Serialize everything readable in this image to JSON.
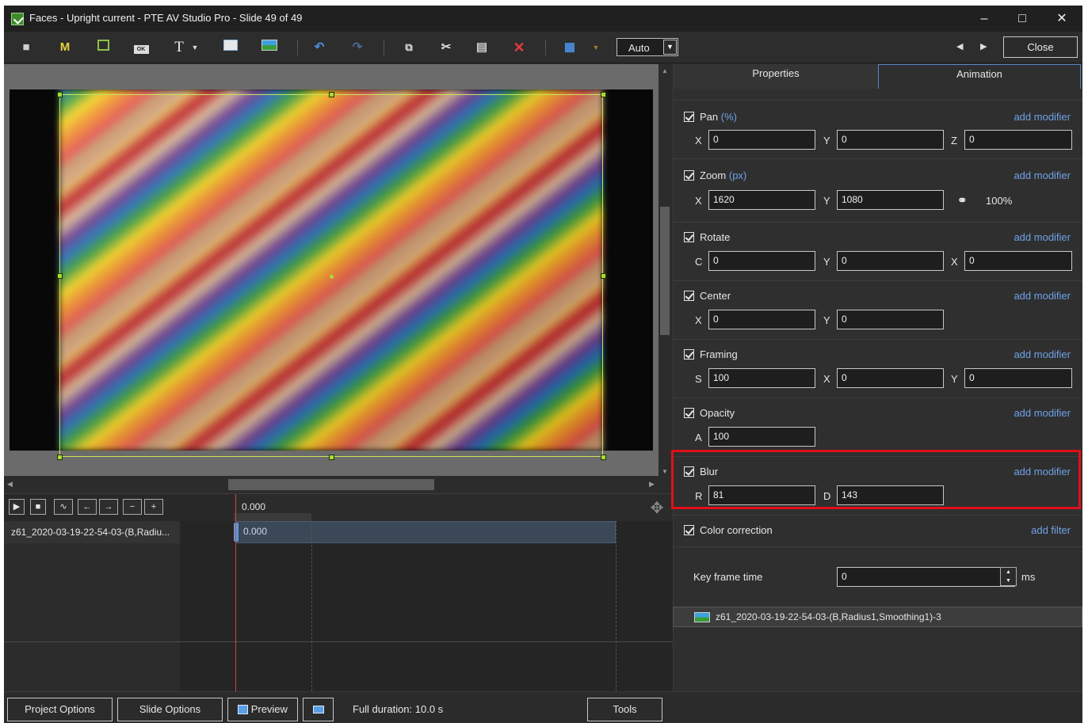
{
  "window": {
    "title": "Faces - Upright current - PTE AV Studio Pro - Slide 49 of 49",
    "minimize": "–",
    "maximize": "□",
    "close": "✕"
  },
  "toolbar": {
    "icons": [
      "camera-icon",
      "mask-icon",
      "frame-icon",
      "button-icon",
      "text-icon",
      "rectangle-icon",
      "image-icon",
      "undo-icon",
      "redo-icon",
      "copy-icon",
      "cut-icon",
      "paste-icon",
      "delete-icon",
      "grid-icon"
    ],
    "m_label": "M",
    "t_label": "T",
    "ok_label": "OK",
    "grid_mode": "Auto",
    "close_label": "Close"
  },
  "timeline": {
    "time": "0.000",
    "track_name": "z61_2020-03-19-22-54-03-(B,Radiu...",
    "clip_time": "0.000"
  },
  "bottom": {
    "project_options": "Project Options",
    "slide_options": "Slide Options",
    "preview": "Preview",
    "duration": "Full duration: 10.0 s",
    "tools": "Tools"
  },
  "panel": {
    "tabs": [
      "Properties",
      "Animation"
    ],
    "active_tab": "Animation",
    "add_modifier": "add modifier",
    "add_filter": "add filter",
    "pan": {
      "title": "Pan",
      "unit": "(%)",
      "labels": [
        "X",
        "Y",
        "Z"
      ],
      "values": [
        "0",
        "0",
        "0"
      ]
    },
    "zoom": {
      "title": "Zoom",
      "unit": "(px)",
      "labels": [
        "X",
        "Y"
      ],
      "values": [
        "1620",
        "1080"
      ],
      "percent": "100%"
    },
    "rotate": {
      "title": "Rotate",
      "labels": [
        "C",
        "Y",
        "X"
      ],
      "values": [
        "0",
        "0",
        "0"
      ]
    },
    "center": {
      "title": "Center",
      "labels": [
        "X",
        "Y"
      ],
      "values": [
        "0",
        "0"
      ]
    },
    "framing": {
      "title": "Framing",
      "labels": [
        "S",
        "X",
        "Y"
      ],
      "values": [
        "100",
        "0",
        "0"
      ]
    },
    "opacity": {
      "title": "Opacity",
      "labels": [
        "A"
      ],
      "values": [
        "100"
      ]
    },
    "blur": {
      "title": "Blur",
      "labels": [
        "R",
        "D"
      ],
      "values": [
        "81",
        "143"
      ]
    },
    "color_correction": "Color correction",
    "keyframe": {
      "label": "Key frame time",
      "value": "0",
      "unit": "ms"
    },
    "layer_name": "z61_2020-03-19-22-54-03-(B,Radius1,Smoothing1)-3"
  },
  "colors": {
    "accent": "#6ea2e6",
    "highlight": "#e0101a",
    "selection": "#c7e65b",
    "playhead": "#d64040"
  }
}
